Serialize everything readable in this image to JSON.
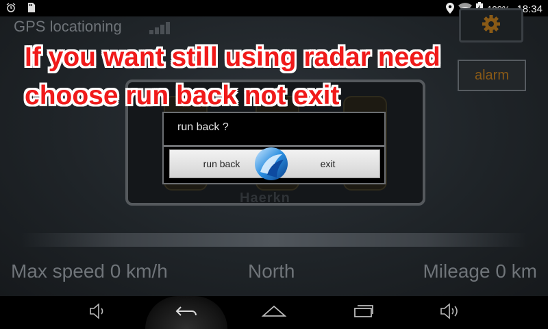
{
  "status_bar": {
    "left_icons": [
      "alarm-clock-icon",
      "sd-card-icon"
    ],
    "right_icons": [
      "location-pin-icon",
      "wifi-icon",
      "battery-charging-icon"
    ],
    "battery_percent": "100%",
    "time": "18:34"
  },
  "gps": {
    "label": "GPS locationing",
    "signal_icon": "signal-bars-icon"
  },
  "top_right": {
    "settings_icon": "gear-icon",
    "alarm_label": "alarm"
  },
  "speed_panel": {
    "brand": "Haerkn"
  },
  "caption": {
    "line1": "If you want still using radar need",
    "line2": "choose run back not exit",
    "color": "#f01a1a"
  },
  "dialog": {
    "title": "run back ?",
    "run_back_label": "run back",
    "exit_label": "exit"
  },
  "stats": {
    "max_speed": "Max speed 0 km/h",
    "direction": "North",
    "mileage": "Mileage 0 km"
  },
  "nav_bar": {
    "icons": [
      "volume-down-icon",
      "back-icon",
      "home-icon",
      "recent-apps-icon",
      "volume-up-icon"
    ]
  }
}
